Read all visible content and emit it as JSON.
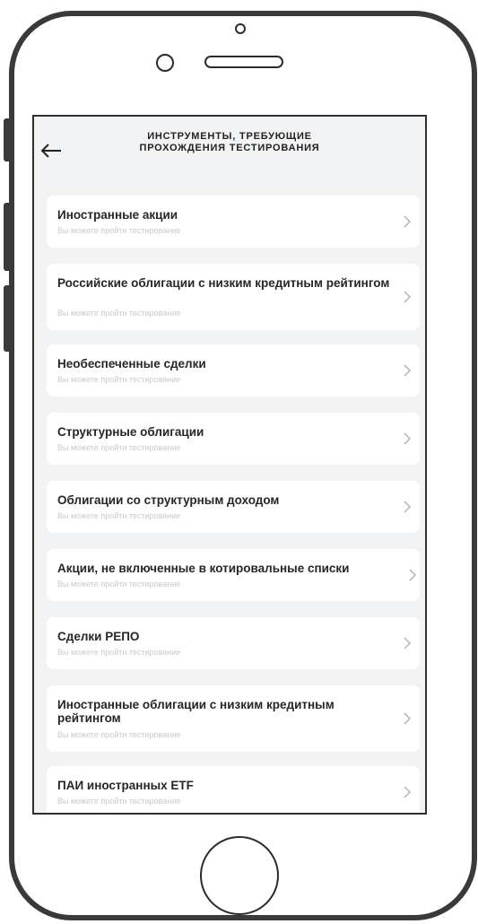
{
  "header": {
    "title_line1": "ИНСТРУМЕНТЫ, ТРЕБУЮЩИЕ",
    "title_line2": "ПРОХОЖДЕНИЯ ТЕСТИРОВАНИЯ",
    "back_icon": "arrow-left-icon"
  },
  "items": [
    {
      "title": "Иностранные акции",
      "subtitle": "Вы можете пройти тестирование"
    },
    {
      "title": "Российские облигации с низким кредитным рейтингом",
      "subtitle": "Вы можете пройти тестирование"
    },
    {
      "title": "Необеспеченные сделки",
      "subtitle": "Вы можете пройти тестирование"
    },
    {
      "title": "Структурные облигации",
      "subtitle": "Вы можете пройти тестирование"
    },
    {
      "title": "Облигации со структурным доходом",
      "subtitle": "Вы можете пройти тестирование"
    },
    {
      "title": "Акции, не включенные в котировальные списки",
      "subtitle": "Вы можете пройти тестирование"
    },
    {
      "title": "Сделки РЕПО",
      "subtitle": "Вы можете пройти тестирование"
    },
    {
      "title": "Иностранные облигации с низким кредитным рейтингом",
      "subtitle": "Вы можете пройти тестирование"
    },
    {
      "title": "ПАИ иностранных ETF",
      "subtitle": "Вы можете пройти тестирование"
    }
  ],
  "colors": {
    "background": "#f2f3f5",
    "card": "#ffffff",
    "title_text": "#262626",
    "subtitle_text": "#c8cacf",
    "chevron": "#b0b3b8"
  }
}
